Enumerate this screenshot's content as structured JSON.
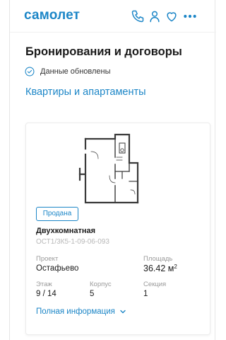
{
  "header": {
    "logo": "самолет",
    "icons": [
      "phone-icon",
      "user-icon",
      "heart-icon",
      "more-icon"
    ]
  },
  "page": {
    "title": "Бронирования и договоры",
    "status_text": "Данные обновлены",
    "section_link": "Квартиры и апартаменты"
  },
  "card": {
    "badge": "Продана",
    "apartment_type": "Двухкомнатная",
    "code": "ОСТ1/3К5-1-09-06-093",
    "project_label": "Проект",
    "project_value": "Остафьево",
    "area_label": "Площадь",
    "area_value": "36.42 м",
    "area_unit_sup": "2",
    "floor_label": "Этаж",
    "floor_value": "9 / 14",
    "building_label": "Корпус",
    "building_value": "5",
    "section_label": "Секция",
    "section_value": "1",
    "more_link": "Полная информация"
  },
  "colors": {
    "brand": "#1c86c7",
    "muted": "#9a9a9a"
  }
}
